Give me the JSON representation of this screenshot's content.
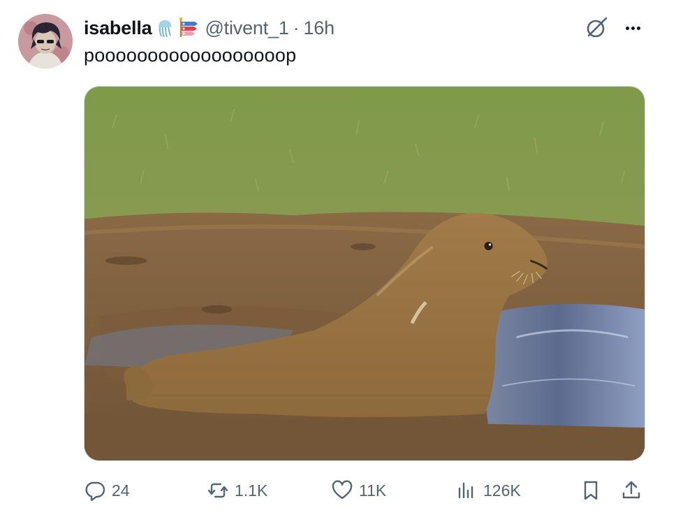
{
  "post": {
    "author": {
      "display_name": "isabella",
      "handle": "@tivent_1",
      "separator": "·",
      "time": "16h",
      "avatar_icon": "avatar",
      "name_emojis": [
        "jellyfish-emoji",
        "koinobori-emoji"
      ]
    },
    "text": "poooooooooooooooooop",
    "media": {
      "type": "photo",
      "icon": "photo"
    },
    "header_icons": [
      "grok-icon",
      "more-icon"
    ],
    "actions": {
      "reply": {
        "icon": "reply-icon",
        "count": "24"
      },
      "repost": {
        "icon": "repost-icon",
        "count": "1.1K"
      },
      "like": {
        "icon": "like-icon",
        "count": "11K"
      },
      "views": {
        "icon": "views-icon",
        "count": "126K"
      },
      "bookmark": {
        "icon": "bookmark-icon"
      },
      "share": {
        "icon": "share-icon"
      }
    }
  },
  "colors": {
    "text_primary": "#0f1419",
    "text_secondary": "#536471",
    "border": "#cfd9de",
    "background": "#ffffff"
  }
}
